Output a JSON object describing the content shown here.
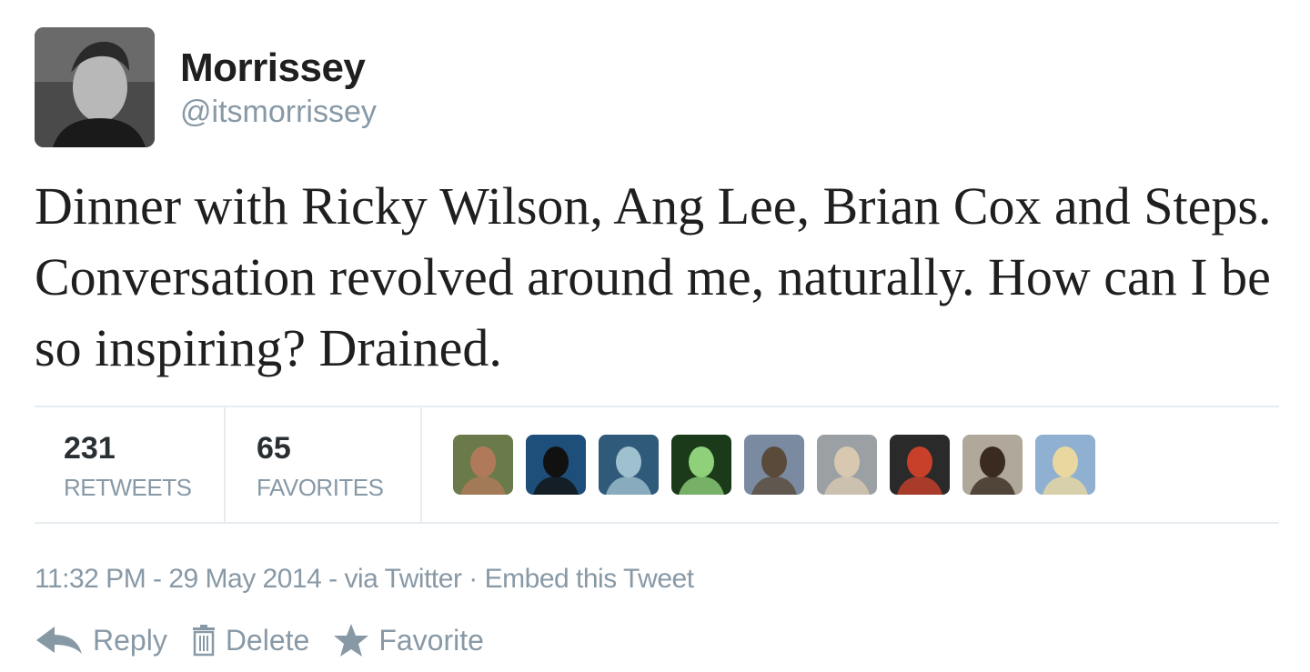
{
  "author": {
    "name": "Morrissey",
    "handle": "@itsmorrissey"
  },
  "tweet": {
    "text": "Dinner with Ricky Wilson, Ang Lee, Brian Cox and Steps. Conversation revolved around me, naturally. How can I be so inspiring? Drained."
  },
  "stats": {
    "retweets_count": "231",
    "retweets_label": "RETWEETS",
    "favorites_count": "65",
    "favorites_label": "FAVORITES"
  },
  "favoriters": [
    {
      "bg": "#6b7a4a",
      "fg": "#b07a5a"
    },
    {
      "bg": "#1e4f7a",
      "fg": "#111111"
    },
    {
      "bg": "#2f5a7a",
      "fg": "#9fc0cf"
    },
    {
      "bg": "#1a3a1a",
      "fg": "#8fd07a"
    },
    {
      "bg": "#7a8aa0",
      "fg": "#5a4a3a"
    },
    {
      "bg": "#9aa0a4",
      "fg": "#d8c8b0"
    },
    {
      "bg": "#2a2a2a",
      "fg": "#c8402a"
    },
    {
      "bg": "#b0a89a",
      "fg": "#3a2a20"
    },
    {
      "bg": "#8fb0d0",
      "fg": "#e8d8a0"
    }
  ],
  "meta": {
    "time": "11:32 PM - 29 May 2014 - via Twitter",
    "separator": "·",
    "embed": "Embed this Tweet"
  },
  "actions": {
    "reply": "Reply",
    "delete": "Delete",
    "favorite": "Favorite"
  },
  "colors": {
    "muted": "#8899a6",
    "text": "#1f1f1f",
    "border": "#e6ecf0"
  }
}
